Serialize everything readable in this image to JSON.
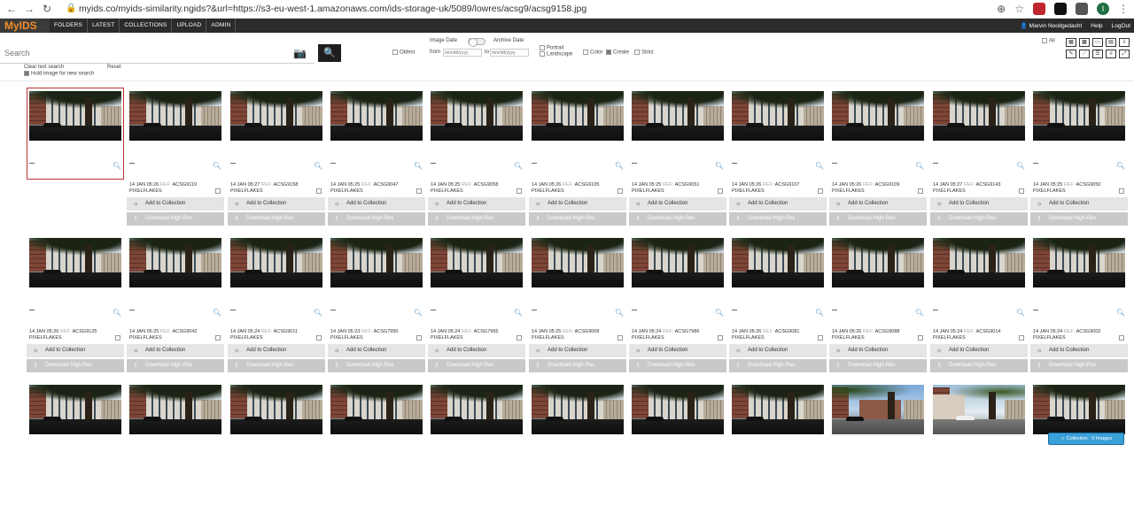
{
  "browser": {
    "url": "myids.co/myids-similarity.ngids?&url=https://s3-eu-west-1.amazonaws.com/ids-storage-uk/5089/lowres/acsg9/acsg9158.jpg",
    "profile_initial": "I"
  },
  "app": {
    "logo": "MyIDS",
    "nav": [
      "FOLDERS",
      "LATEST",
      "COLLECTIONS",
      "UPLOAD",
      "ADMIN"
    ],
    "user": "Marvin Nooitgedacht",
    "help": "Help",
    "logout": "LogOut"
  },
  "search": {
    "placeholder": "Search",
    "clear_label": "Clear text search",
    "reset_label": "Reset",
    "hold_label": "Hold image for new search",
    "image_date": "Image Date",
    "archive_date": "Archive Date",
    "oldest": "Oldest",
    "from": "from",
    "to": "to",
    "date_placeholder": "mm/dd/yyyy",
    "portrait": "Portrait",
    "landscape": "Landscape",
    "color": "Color",
    "create": "Create",
    "strict": "Strict",
    "all": "All"
  },
  "card_labels": {
    "ref": "REF:",
    "add": "Add to Collection",
    "download": "Download High-Res"
  },
  "rows": [
    [
      {
        "date": "",
        "code": "",
        "agency": ""
      },
      {
        "date": "14 JAN 05:26",
        "code": "ACSG9119",
        "agency": "PIXELFLAKES"
      },
      {
        "date": "14 JAN 05:27",
        "code": "ACSG9158",
        "agency": "PIXELFLAKES"
      },
      {
        "date": "14 JAN 05:25",
        "code": "ACSG9047",
        "agency": "PIXELFLAKES"
      },
      {
        "date": "14 JAN 05:25",
        "code": "ACSG9058",
        "agency": "PIXELFLAKES"
      },
      {
        "date": "14 JAN 05:26",
        "code": "ACSG9105",
        "agency": "PIXELFLAKES"
      },
      {
        "date": "14 JAN 05:25",
        "code": "ACSG9051",
        "agency": "PIXELFLAKES"
      },
      {
        "date": "14 JAN 05:26",
        "code": "ACSG9107",
        "agency": "PIXELFLAKES"
      },
      {
        "date": "14 JAN 05:26",
        "code": "ACSG9109",
        "agency": "PIXELFLAKES"
      },
      {
        "date": "14 JAN 05:27",
        "code": "ACSG9143",
        "agency": "PIXELFLAKES"
      },
      {
        "date": "14 JAN 05:25",
        "code": "ACSG9050",
        "agency": "PIXELFLAKES"
      }
    ],
    [
      {
        "date": "14 JAN 05:26",
        "code": "ACSG9125",
        "agency": "PIXELFLAKES"
      },
      {
        "date": "14 JAN 05:25",
        "code": "ACSG9042",
        "agency": "PIXELFLAKES"
      },
      {
        "date": "14 JAN 05:24",
        "code": "ACSG9011",
        "agency": "PIXELFLAKES"
      },
      {
        "date": "14 JAN 05:23",
        "code": "ACSG7950",
        "agency": "PIXELFLAKES"
      },
      {
        "date": "14 JAN 05:24",
        "code": "ACSG7965",
        "agency": "PIXELFLAKES"
      },
      {
        "date": "14 JAN 05:25",
        "code": "ACSG9069",
        "agency": "PIXELFLAKES"
      },
      {
        "date": "14 JAN 05:24",
        "code": "ACSG7986",
        "agency": "PIXELFLAKES"
      },
      {
        "date": "14 JAN 05:26",
        "code": "ACSG9081",
        "agency": "PIXELFLAKES"
      },
      {
        "date": "14 JAN 05:26",
        "code": "ACSG9088",
        "agency": "PIXELFLAKES"
      },
      {
        "date": "14 JAN 05:24",
        "code": "ACSG9014",
        "agency": "PIXELFLAKES"
      },
      {
        "date": "14 JAN 05:24",
        "code": "ACSG9002",
        "agency": "PIXELFLAKES"
      }
    ],
    [
      {
        "alt": ""
      },
      {
        "alt": ""
      },
      {
        "alt": ""
      },
      {
        "alt": ""
      },
      {
        "alt": ""
      },
      {
        "alt": ""
      },
      {
        "alt": ""
      },
      {
        "alt": ""
      },
      {
        "alt": "street"
      },
      {
        "alt": "road"
      },
      {
        "alt": ""
      }
    ]
  ],
  "collection": {
    "label": "Collection",
    "sep": ":",
    "count": "0 Images"
  },
  "colors": {
    "accent": "#f28c28",
    "badge": "#3aa0d8",
    "navbar": "#2b2b2b"
  }
}
